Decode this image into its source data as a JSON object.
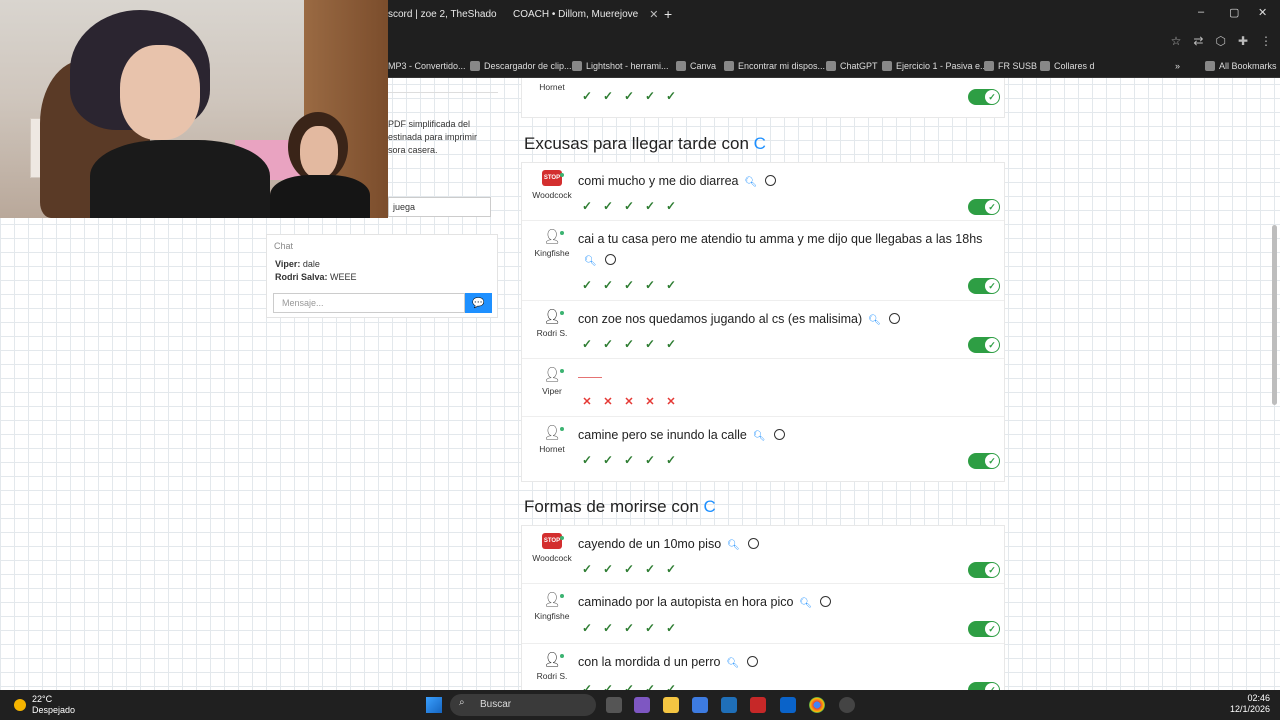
{
  "browser": {
    "tabs": [
      {
        "label": "scord | zoe 2, TheShado"
      },
      {
        "label": "COACH • Dillom, Muerejove"
      }
    ],
    "new_tab_label": "+",
    "window_controls": [
      "–",
      "▢",
      "✕"
    ],
    "bookmarks": [
      "MP3 - Convertido...",
      "Descargador de clip...",
      "Lightshot - herrami...",
      "Canva",
      "Encontrar mi dispos...",
      "ChatGPT",
      "Ejercicio 1 - Pasiva e...",
      "FR SUSB",
      "Collares d",
      "All Bookmarks"
    ]
  },
  "left_panel": {
    "description": "PDF simplificada del\nestinada para imprimir\nsora casera.",
    "search_value": "juega",
    "chat": {
      "title": "Chat",
      "messages": [
        {
          "user": "Viper:",
          "text": "dale"
        },
        {
          "user": "Rodri Salva:",
          "text": "WEEE"
        }
      ],
      "input_placeholder": "Mensaje..."
    }
  },
  "content": {
    "top_row": {
      "player": "Hornet"
    },
    "sections": [
      {
        "title": "Excusas para llegar tarde con",
        "letter": "C",
        "answers": [
          {
            "player": "Woodcock",
            "avatar": "stop",
            "text": "comi mucho y me dio diarrea",
            "valid": true
          },
          {
            "player": "Kingfishe",
            "avatar": "user",
            "text": "cai a tu casa pero me atendio tu amma y me dijo que llegabas a las 18hs",
            "valid": true
          },
          {
            "player": "Rodri S.",
            "avatar": "user-dark",
            "text": "con zoe nos quedamos jugando al cs (es malisima)",
            "valid": true
          },
          {
            "player": "Viper",
            "avatar": "user",
            "text": "",
            "valid": false
          },
          {
            "player": "Hornet",
            "avatar": "user",
            "text": "camine pero se inundo la calle",
            "valid": true
          }
        ]
      },
      {
        "title": "Formas de morirse con",
        "letter": "C",
        "answers": [
          {
            "player": "Woodcock",
            "avatar": "stop",
            "text": "cayendo de un 10mo piso",
            "valid": true
          },
          {
            "player": "Kingfishe",
            "avatar": "user",
            "text": "caminado por la autopista en hora pico",
            "valid": true
          },
          {
            "player": "Rodri S.",
            "avatar": "user-dark",
            "text": "con la mordida d un perro",
            "valid": true
          }
        ]
      }
    ],
    "stop_badge": "STOP"
  },
  "taskbar": {
    "temperature": "22°C",
    "weather": "Despejado",
    "search_label": "Buscar",
    "time": "02:46",
    "date": "12/1/2026"
  },
  "colors": {
    "accent": "#1e90ff",
    "valid_green": "#2e9e44",
    "invalid_red": "#e53935"
  }
}
